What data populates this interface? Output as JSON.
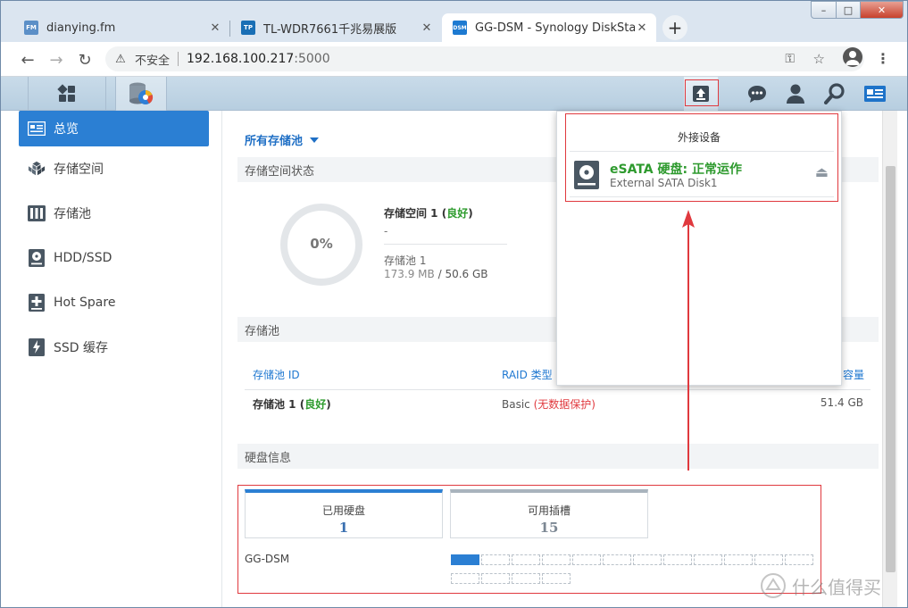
{
  "browser": {
    "tabs": [
      {
        "title": "dianying.fm",
        "favicon": "FM",
        "favicon_color": "#5b8fc7",
        "active": false
      },
      {
        "title": "TL-WDR7661千兆易展版",
        "favicon": "TP",
        "favicon_color": "#1a6fb5",
        "active": false
      },
      {
        "title": "GG-DSM - Synology DiskStatio",
        "favicon": "DSM",
        "favicon_color": "#1d7ad1",
        "active": true
      }
    ],
    "new_tab": "+",
    "window_controls": {
      "minimize": "–",
      "maximize": "□",
      "close": "✕"
    },
    "security_label": "不安全",
    "url_host": "192.168.100.217",
    "url_port": ":5000"
  },
  "taskbar": {
    "left_icons": [
      "main-menu-icon",
      "storage-manager-app-icon"
    ],
    "right_icons": [
      "external-device-icon",
      "notifications-icon",
      "user-icon",
      "search-icon",
      "widgets-icon"
    ]
  },
  "sidebar": {
    "items": [
      {
        "label": "总览",
        "icon": "overview-icon",
        "active": true
      },
      {
        "label": "存储空间",
        "icon": "volume-icon",
        "active": false
      },
      {
        "label": "存储池",
        "icon": "storage-pool-icon",
        "active": false
      },
      {
        "label": "HDD/SSD",
        "icon": "hdd-icon",
        "active": false
      },
      {
        "label": "Hot Spare",
        "icon": "hot-spare-icon",
        "active": false
      },
      {
        "label": "SSD 缓存",
        "icon": "ssd-cache-icon",
        "active": false
      }
    ]
  },
  "main": {
    "pool_selector": "所有存储池",
    "volume_status": {
      "header": "存储空间状态",
      "percent": "0%",
      "percent_fraction": 0,
      "volume_name": "存储空间 1",
      "volume_state": "良好",
      "volume_detail": "-",
      "pool_name": "存储池 1",
      "used": "173.9 MB",
      "separator": "/",
      "total": "50.6 GB"
    },
    "pool_section": {
      "header": "存储池",
      "columns": [
        "存储池 ID",
        "RAID 类型",
        "容量"
      ],
      "rows": [
        {
          "id": "存储池 1",
          "state": "良好",
          "raid": "Basic",
          "raid_note": "(无数据保护)",
          "capacity": "51.4 GB"
        }
      ]
    },
    "disk_section": {
      "header": "硬盘信息",
      "used_label": "已用硬盘",
      "used_value": "1",
      "free_label": "可用插槽",
      "free_value": "15",
      "nas_name": "GG-DSM",
      "slots_total": 16,
      "slots_used": 1
    }
  },
  "popover": {
    "title": "外接设备",
    "device_name": "eSATA 硬盘: 正常运作",
    "device_sub": "External SATA Disk1",
    "eject": "⏏"
  },
  "watermark": "什么值得买",
  "colors": {
    "accent": "#2b7fd3",
    "good": "#2c9b2c",
    "warning_red": "#e0393e",
    "device_green": "#2e9a2e"
  }
}
